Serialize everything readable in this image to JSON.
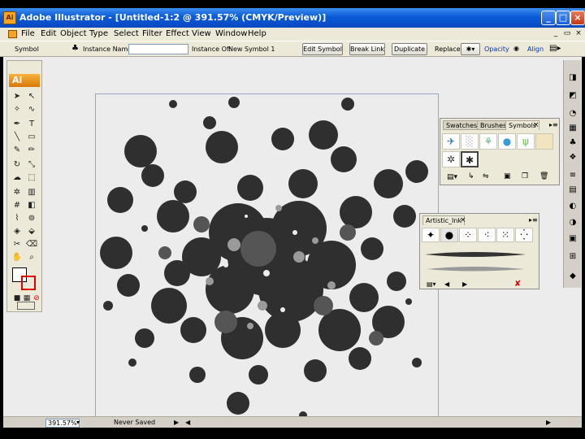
{
  "window": {
    "title": "Adobe Illustrator - [Untitled-1:2 @ 391.57% (CMYK/Preview)]",
    "app_icon": "Ai"
  },
  "menu": [
    "File",
    "Edit",
    "Object",
    "Type",
    "Select",
    "Filter",
    "Effect",
    "View",
    "Window",
    "Help"
  ],
  "control_bar": {
    "object_type": "Symbol",
    "instance_name_label": "Instance Name:",
    "instance_name_value": "",
    "instance_of_label": "Instance Of:",
    "instance_of_value": "New Symbol 1",
    "edit_symbol": "Edit Symbol",
    "break_link": "Break Link",
    "duplicate": "Duplicate",
    "replace_label": "Replace:",
    "opacity_label": "Opacity",
    "align_label": "Align"
  },
  "tools_panel": {
    "logo": "Ai"
  },
  "symbols_panel": {
    "tabs": [
      "Swatches",
      "Brushes",
      "Symbols"
    ],
    "active_tab": "Symbols",
    "close_glyph": "×"
  },
  "brush_panel": {
    "title": "Artistic_Ink",
    "close_glyph": "×"
  },
  "status_bar": {
    "zoom": "391.57%",
    "status": "Never Saved"
  },
  "colors": {
    "accent_orange": "#f3a623",
    "titlebar_blue": "#0a5ad8",
    "splatter": "#2f2f2f"
  }
}
